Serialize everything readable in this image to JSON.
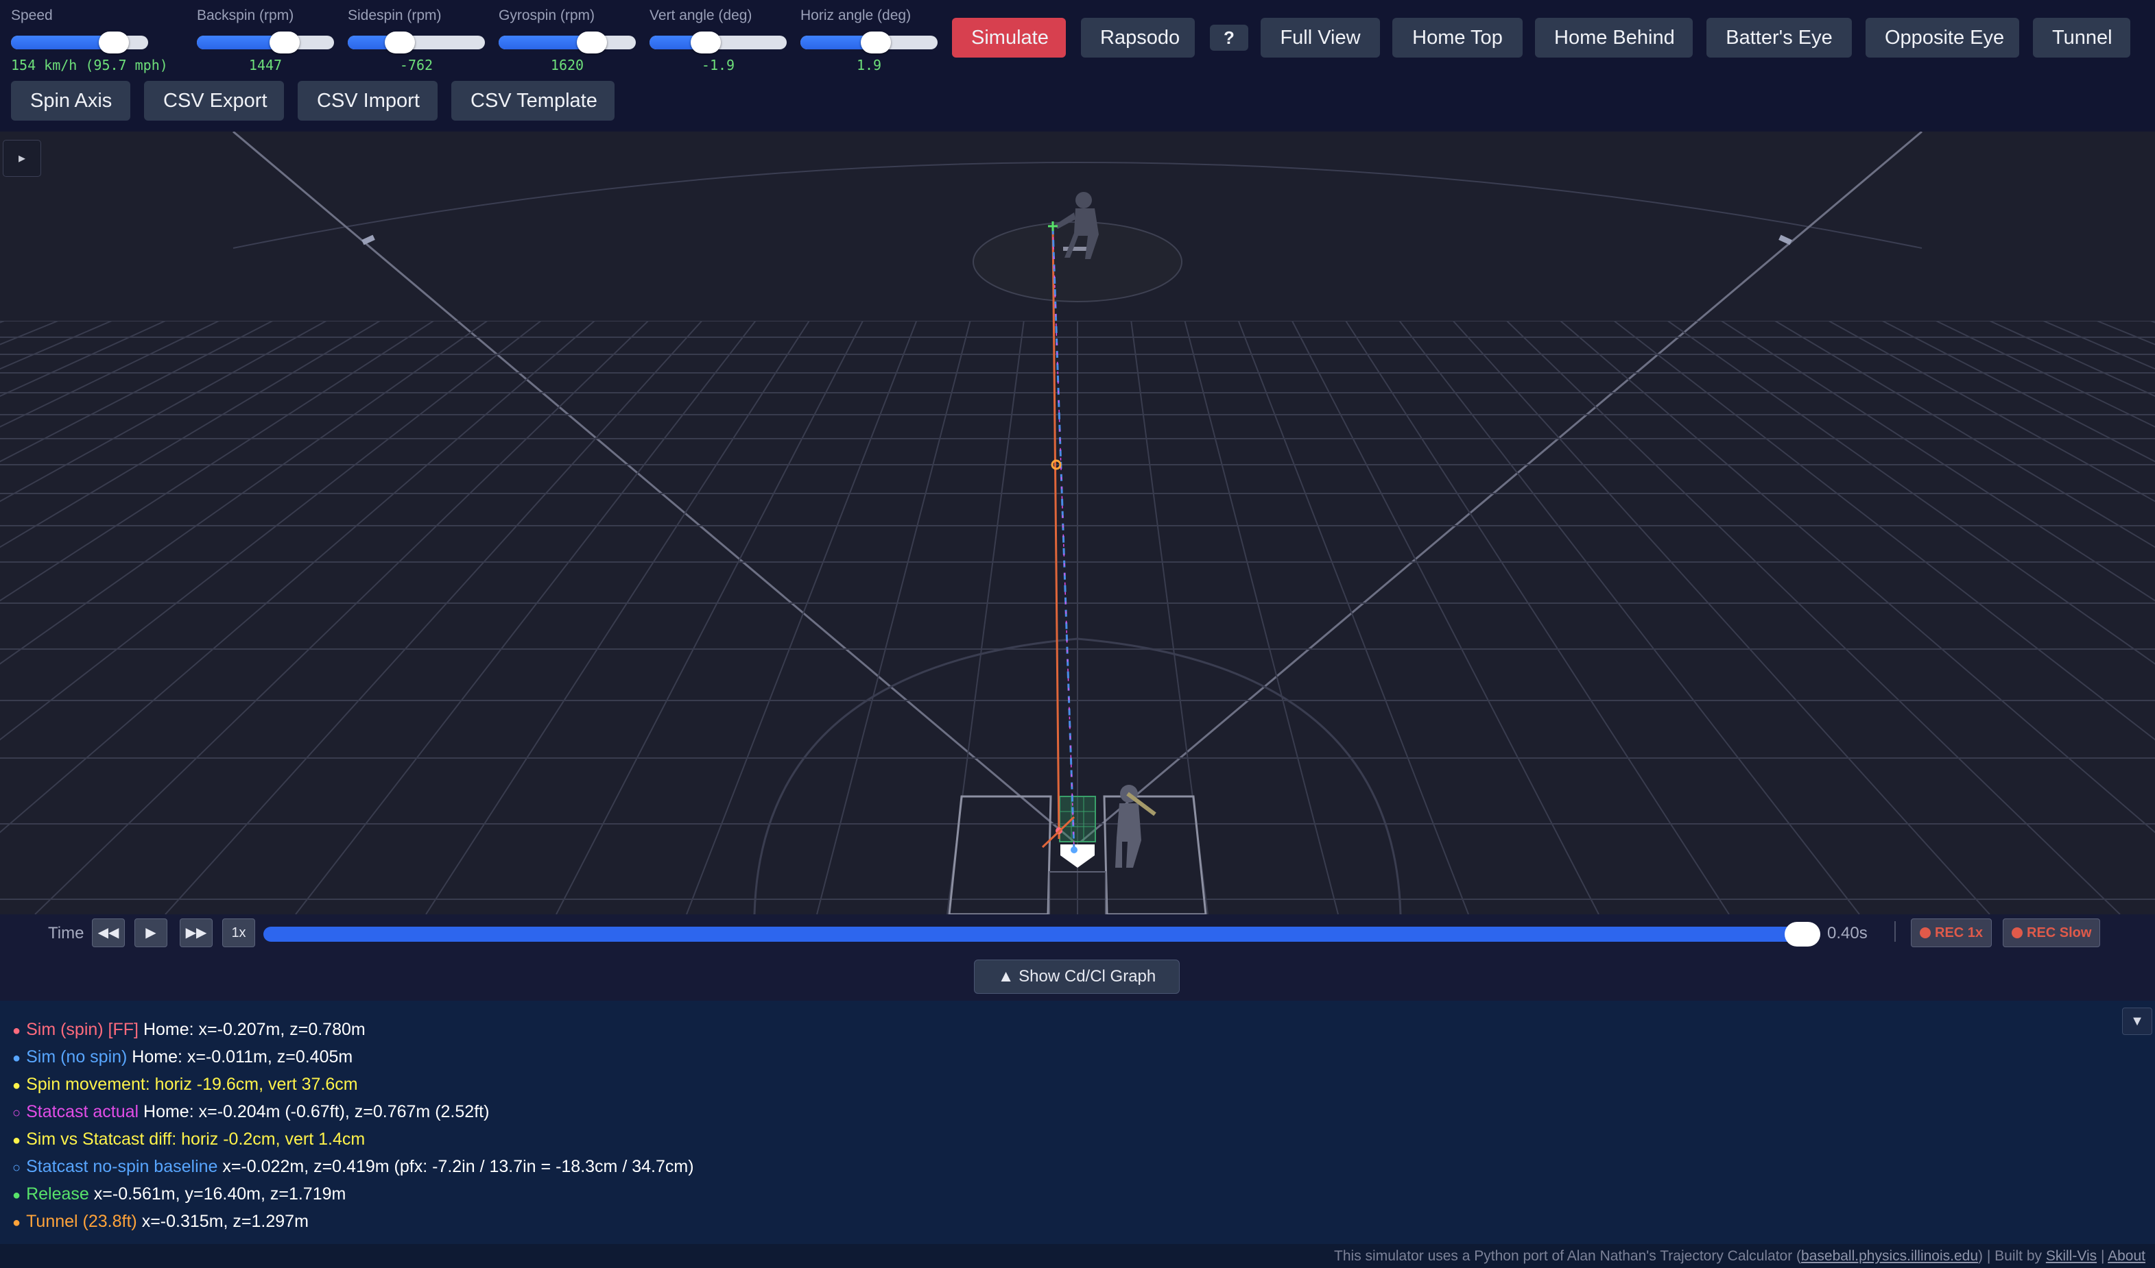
{
  "sliders": [
    {
      "label": "Speed",
      "value_text": "154 km/h (95.7 mph)",
      "fill": 0.75
    },
    {
      "label": "Backspin (rpm)",
      "value_text": "1447",
      "fill": 0.64
    },
    {
      "label": "Sidespin (rpm)",
      "value_text": "-762",
      "fill": 0.38
    },
    {
      "label": "Gyrospin (rpm)",
      "value_text": "1620",
      "fill": 0.68
    },
    {
      "label": "Vert angle (deg)",
      "value_text": "-1.9",
      "fill": 0.41
    },
    {
      "label": "Horiz angle (deg)",
      "value_text": "1.9",
      "fill": 0.55
    }
  ],
  "buttons": {
    "simulate": "Simulate",
    "rapsodo": "Rapsodo",
    "help": "?",
    "full_view": "Full View",
    "home_top": "Home Top",
    "home_behind": "Home Behind",
    "batters_eye": "Batter's Eye",
    "opposite_eye": "Opposite Eye",
    "tunnel": "Tunnel",
    "spin_axis": "Spin Axis",
    "csv_export": "CSV Export",
    "csv_import": "CSV Import",
    "csv_template": "CSV Template"
  },
  "viewport": {
    "panel_toggle": "▸"
  },
  "timeline": {
    "label": "Time",
    "rewind": "◀◀",
    "play": "▶",
    "forward": "▶▶",
    "speed": "1x",
    "progress": 1.0,
    "time_value": "0.40s",
    "rec_1x": "REC 1x",
    "rec_slow": "REC Slow"
  },
  "graph_toggle": "▲ Show Cd/Cl Graph",
  "info_rows": [
    {
      "bullet": "●",
      "label": "Sim (spin) [FF]",
      "text": " Home: x=-0.207m, z=0.780m",
      "color": "#ff6b7d"
    },
    {
      "bullet": "●",
      "label": "Sim (no spin)",
      "text": " Home: x=-0.011m, z=0.405m",
      "color": "#58a6ff"
    },
    {
      "bullet": "●",
      "label": "Spin movement: horiz -19.6cm, vert 37.6cm",
      "text": "",
      "color": "#fff34a"
    },
    {
      "bullet": "○",
      "label": "Statcast actual",
      "text": " Home: x=-0.204m (-0.67ft), z=0.767m (2.52ft)",
      "color": "#e24de6"
    },
    {
      "bullet": "●",
      "label": "Sim vs Statcast diff: horiz -0.2cm, vert 1.4cm",
      "text": "",
      "color": "#fff34a"
    },
    {
      "bullet": "○",
      "label": "Statcast no-spin baseline",
      "text": " x=-0.022m, z=0.419m (pfx: -7.2in / 13.7in = -18.3cm / 34.7cm)",
      "color": "#58a6ff"
    },
    {
      "bullet": "●",
      "label": "Release",
      "text": " x=-0.561m, y=16.40m, z=1.719m",
      "color": "#58e36a"
    },
    {
      "bullet": "●",
      "label": "Tunnel (23.8ft)",
      "text": " x=-0.315m, z=1.297m",
      "color": "#ffa33a"
    }
  ],
  "collapse_button": "▼",
  "footer": {
    "prefix": "This simulator uses a Python port of Alan Nathan's Trajectory Calculator (",
    "link1": "baseball.physics.illinois.edu",
    "middle": ")  |  Built by ",
    "link2": "Skill-Vis",
    "sep": "  |  ",
    "link3": "About"
  },
  "colors": {
    "simulate": "#d7404f",
    "spin_trajectory": "#e0663a",
    "nospin_trajectory": "#4a8de8",
    "release": "#58e36a"
  }
}
